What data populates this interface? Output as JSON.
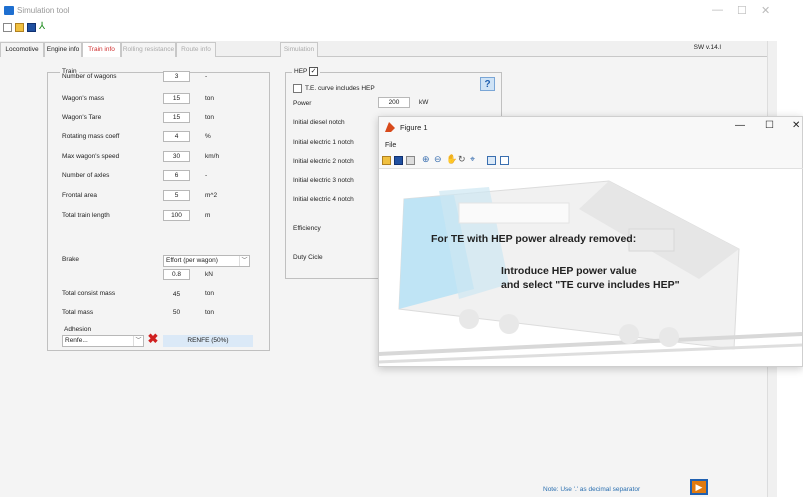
{
  "app": {
    "title": "Simulation tool",
    "version": "SW v.14.l"
  },
  "window_controls": {
    "minimize": "—",
    "maximize": "☐",
    "close": "✕"
  },
  "tabs": [
    {
      "label": "Locomotive info",
      "state": "normal"
    },
    {
      "label": "Engine info",
      "state": "normal"
    },
    {
      "label": "Train info",
      "state": "active"
    },
    {
      "label": "Rolling resistance",
      "state": "disabled"
    },
    {
      "label": "Route info",
      "state": "disabled"
    },
    {
      "label": "Simulation",
      "state": "disabled"
    }
  ],
  "train": {
    "legend": "Train",
    "rows": [
      {
        "label": "Number of wagons",
        "value": "3",
        "unit": "-"
      },
      {
        "label": "Wagon's mass",
        "value": "15",
        "unit": "ton"
      },
      {
        "label": "Wagon's Tare",
        "value": "15",
        "unit": "ton"
      },
      {
        "label": "Rotating mass coeff",
        "value": "4",
        "unit": "%"
      },
      {
        "label": "Max wagon's speed",
        "value": "30",
        "unit": "km/h"
      },
      {
        "label": "Number of axles",
        "value": "6",
        "unit": "-"
      },
      {
        "label": "Frontal area",
        "value": "5",
        "unit": "m^2"
      },
      {
        "label": "Total train length",
        "value": "100",
        "unit": "m"
      }
    ],
    "brake": {
      "label": "Brake",
      "selected": "Effort (per wagon)",
      "value": "0.8",
      "unit": "kN"
    },
    "total_consist_mass": {
      "label": "Total consist mass",
      "value": "45",
      "unit": "ton"
    },
    "total_mass": {
      "label": "Total mass",
      "value": "50",
      "unit": "ton"
    },
    "adhesion": {
      "label": "Adhesion",
      "selected": "Renfe...",
      "result": "RENFE (50%)"
    }
  },
  "hep": {
    "legend": "HEP",
    "checked": true,
    "te_curve_label": "T.E. curve includes HEP",
    "te_curve_checked": false,
    "help": "?",
    "power": {
      "label": "Power",
      "value": "200",
      "unit": "kW"
    },
    "notches": [
      "Initial diesel notch",
      "Initial electric 1 notch",
      "Initial electric 2 notch",
      "Initial electric 3 notch",
      "Initial electric 4 notch"
    ],
    "efficiency": "Efficiency",
    "duty": "Duty Cicle"
  },
  "figure": {
    "title": "Figure 1",
    "menu": "File",
    "line1": "For TE with HEP power already removed:",
    "line2": "Introduce HEP power value",
    "line3": "and select \"TE curve includes HEP\""
  },
  "footer": {
    "note": "Note: Use '.' as decimal separator"
  },
  "colors": {
    "active_tab": "#d03030",
    "accent": "#1e6fd0",
    "delete": "#d02020",
    "run": "#e07a10"
  }
}
